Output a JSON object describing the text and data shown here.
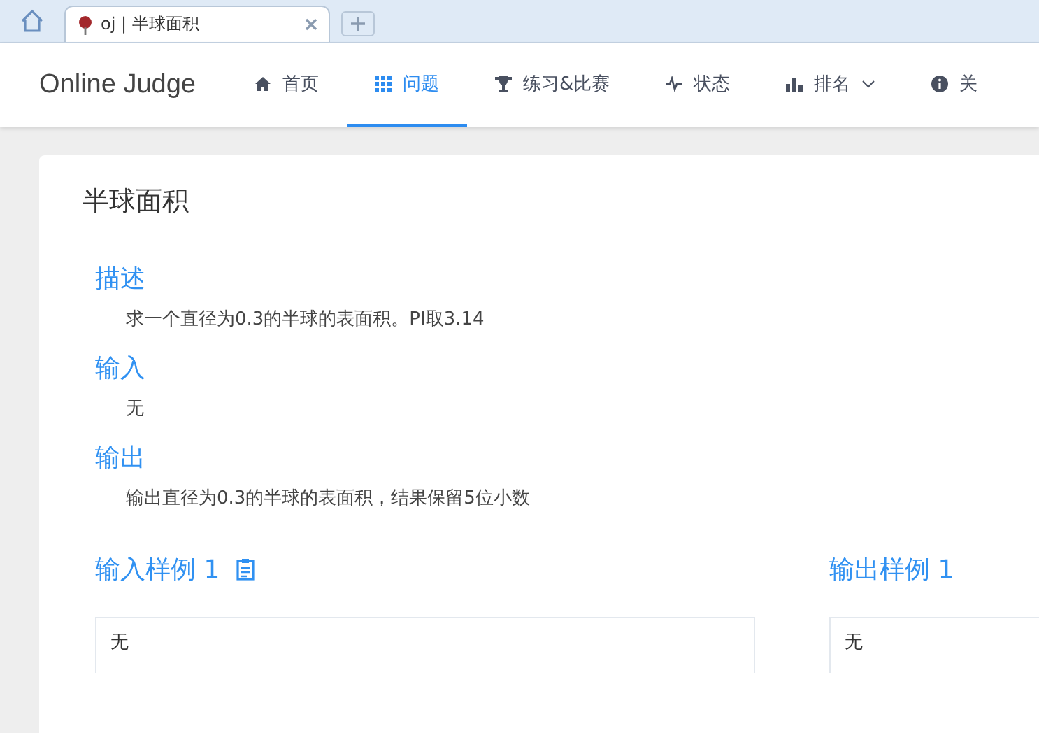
{
  "browser_tab": {
    "title": "oj | 半球面积"
  },
  "nav": {
    "logo": "Online Judge",
    "items": [
      {
        "kind": "home",
        "label": "首页",
        "selected": false,
        "dropdown": false
      },
      {
        "kind": "grid",
        "label": "问题",
        "selected": true,
        "dropdown": false
      },
      {
        "kind": "trophy",
        "label": "练习&比赛",
        "selected": false,
        "dropdown": false
      },
      {
        "kind": "pulse",
        "label": "状态",
        "selected": false,
        "dropdown": false
      },
      {
        "kind": "bars",
        "label": "排名",
        "selected": false,
        "dropdown": true
      },
      {
        "kind": "info",
        "label": "关",
        "selected": false,
        "dropdown": false
      }
    ]
  },
  "problem": {
    "title": "半球面积",
    "sections": [
      {
        "heading": "描述",
        "text": "求一个直径为0.3的半球的表面积。PI取3.14"
      },
      {
        "heading": "输入",
        "text": "无"
      },
      {
        "heading": "输出",
        "text": "输出直径为0.3的半球的表面积，结果保留5位小数"
      }
    ],
    "samples": [
      {
        "heading": "输入样例 1",
        "copy": true,
        "value": "无"
      },
      {
        "heading": "输出样例 1",
        "copy": false,
        "value": "无"
      }
    ]
  }
}
